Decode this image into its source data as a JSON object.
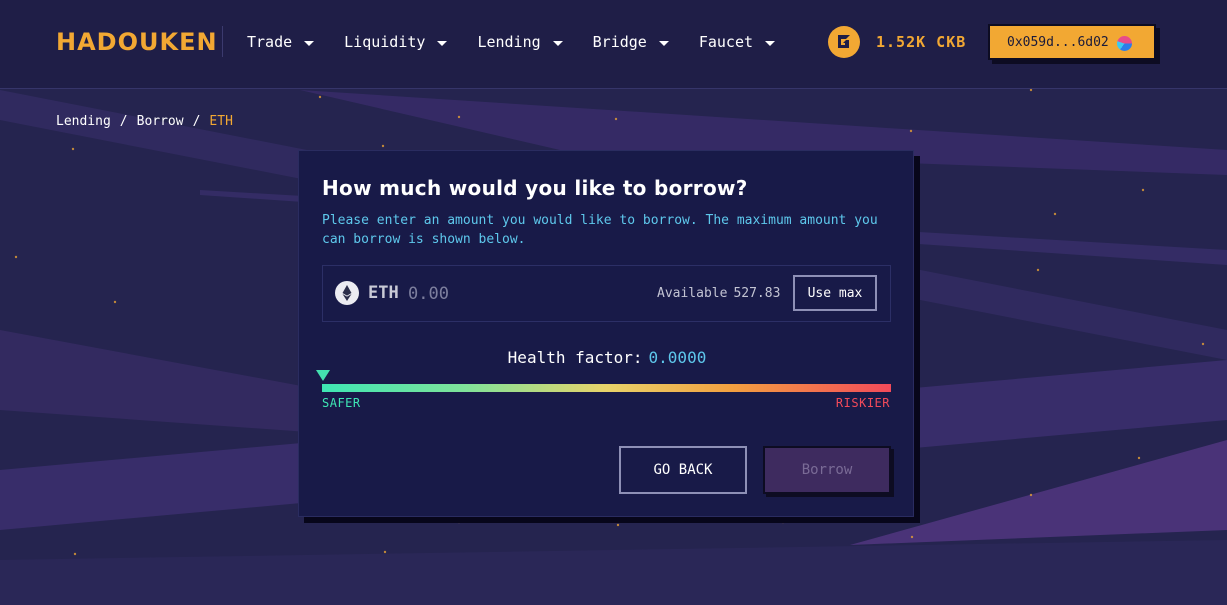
{
  "header": {
    "logo_text": "HADOUKEN",
    "nav": [
      {
        "label": "Trade"
      },
      {
        "label": "Liquidity"
      },
      {
        "label": "Lending"
      },
      {
        "label": "Bridge"
      },
      {
        "label": "Faucet"
      }
    ],
    "balance": "1.52K CKB",
    "wallet_address": "0x059d...6d02"
  },
  "breadcrumb": {
    "items": [
      "Lending",
      "Borrow"
    ],
    "current": "ETH",
    "separator": "/"
  },
  "borrow": {
    "title": "How much would you like to borrow?",
    "description": "Please enter an amount you would like to borrow. The maximum amount you can borrow is shown below.",
    "token_symbol": "ETH",
    "amount_placeholder": "0.00",
    "available_label": "Available",
    "available_value": "527.83",
    "use_max_label": "Use max",
    "health_label": "Health factor:",
    "health_value": "0.0000",
    "safer_label": "SAFER",
    "riskier_label": "RISKIER",
    "go_back_label": "GO BACK",
    "borrow_label": "Borrow"
  },
  "colors": {
    "accent": "#f2a833",
    "info": "#5ec8ec",
    "safe": "#3ee6b4",
    "risk": "#f24a5a",
    "background": "#25244f"
  },
  "icons": {
    "balance": "ckb-coin-icon",
    "token": "ethereum-icon",
    "wallet": "wallet-avatar-icon"
  }
}
